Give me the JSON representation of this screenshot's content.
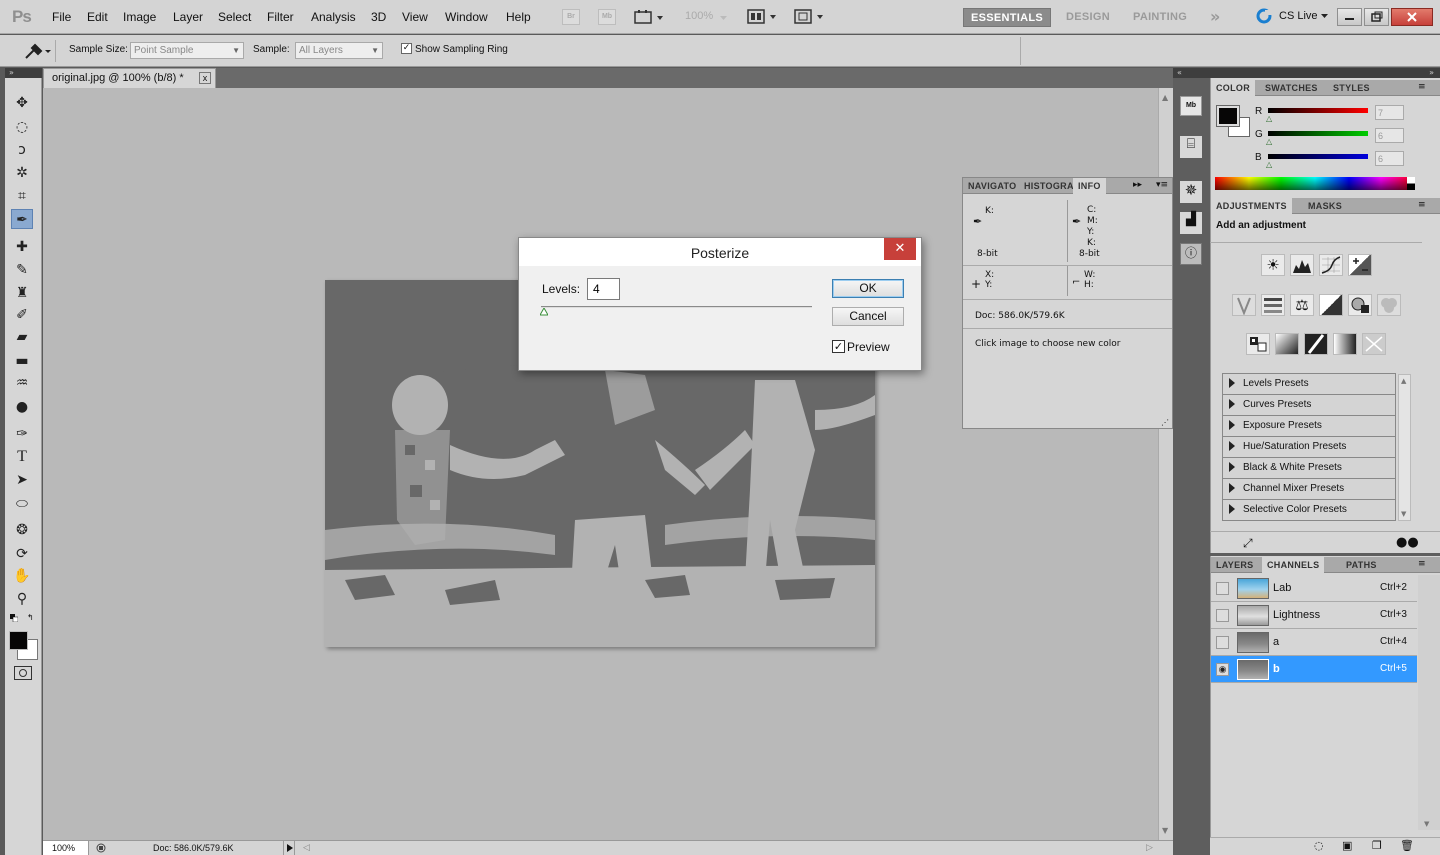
{
  "menubar": {
    "logo": "Ps",
    "items": [
      "File",
      "Edit",
      "Image",
      "Layer",
      "Select",
      "Filter",
      "Analysis",
      "3D",
      "View",
      "Window",
      "Help"
    ],
    "bridge": "Br",
    "minibridge": "Mb",
    "zoom": "100%",
    "workspaces": [
      "ESSENTIALS",
      "DESIGN",
      "PAINTING"
    ],
    "more": "»",
    "cslive": "CS Live"
  },
  "options": {
    "sample_size_label": "Sample Size:",
    "sample_size_value": "Point Sample",
    "sample_label": "Sample:",
    "sample_value": "All Layers",
    "show_ring_label": "Show Sampling Ring",
    "show_ring_checked": true
  },
  "document": {
    "tab_title": "original.jpg @ 100% (b/8) *",
    "tab_close": "x",
    "status_zoom": "100%",
    "status_doc": "Doc: 586.0K/579.6K"
  },
  "dialog": {
    "title": "Posterize",
    "close": "✕",
    "levels_label": "Levels:",
    "levels_value": "4",
    "ok": "OK",
    "cancel": "Cancel",
    "preview_label": "Preview",
    "preview_checked": true
  },
  "info_panel": {
    "tabs": [
      "NAVIGATO",
      "HISTOGRA",
      "INFO"
    ],
    "k": "K:",
    "c": "C:",
    "m": "M:",
    "y": "Y:",
    "k2": "K:",
    "bit1": "8-bit",
    "bit2": "8-bit",
    "x": "X:",
    "yy": "Y:",
    "w": "W:",
    "h": "H:",
    "doc": "Doc: 586.0K/579.6K",
    "hint": "Click image to choose new color"
  },
  "color_panel": {
    "tabs": [
      "COLOR",
      "SWATCHES",
      "STYLES"
    ],
    "r_label": "R",
    "g_label": "G",
    "b_label": "B",
    "r_value": "7",
    "g_value": "6",
    "b_value": "6"
  },
  "adjustments": {
    "tabs": [
      "ADJUSTMENTS",
      "MASKS"
    ],
    "title": "Add an adjustment",
    "presets": [
      "Levels Presets",
      "Curves Presets",
      "Exposure Presets",
      "Hue/Saturation Presets",
      "Black & White Presets",
      "Channel Mixer Presets",
      "Selective Color Presets"
    ]
  },
  "channels": {
    "tabs": [
      "LAYERS",
      "CHANNELS",
      "PATHS"
    ],
    "rows": [
      {
        "name": "Lab",
        "shortcut": "Ctrl+2",
        "visible": false,
        "selected": false
      },
      {
        "name": "Lightness",
        "shortcut": "Ctrl+3",
        "visible": false,
        "selected": false
      },
      {
        "name": "a",
        "shortcut": "Ctrl+4",
        "visible": false,
        "selected": false
      },
      {
        "name": "b",
        "shortcut": "Ctrl+5",
        "visible": true,
        "selected": true
      }
    ]
  },
  "colors": {
    "accent": "#3399ff",
    "close_red": "#c7403a"
  }
}
